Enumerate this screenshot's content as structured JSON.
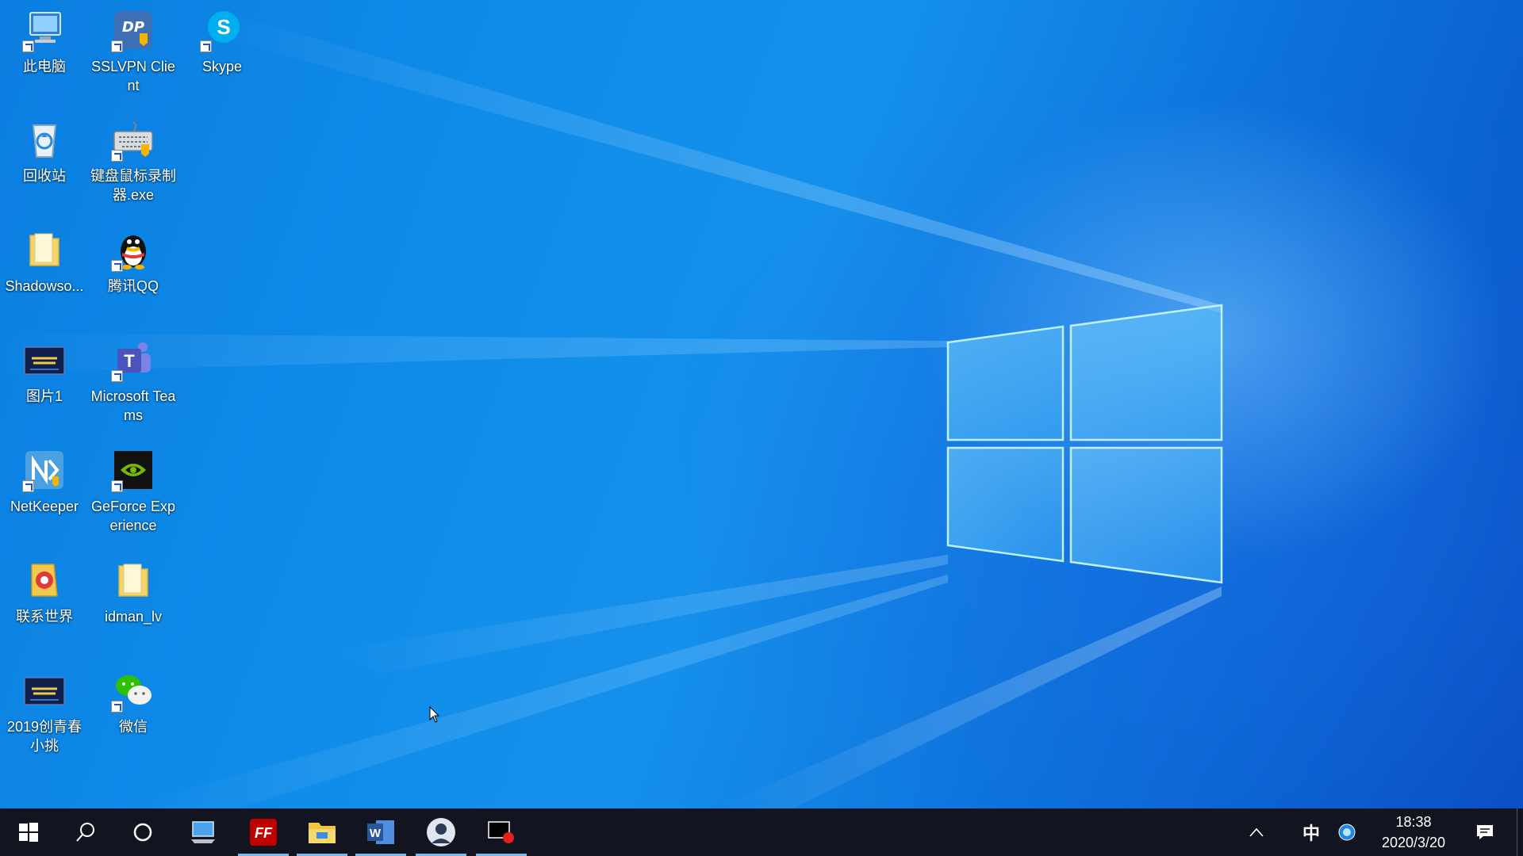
{
  "desktop": {
    "icons": [
      {
        "label": "此电脑",
        "icon": "this-pc-icon"
      },
      {
        "label": "SSLVPN Client",
        "icon": "sslvpn-icon"
      },
      {
        "label": "Skype",
        "icon": "skype-icon"
      },
      {
        "label": "回收站",
        "icon": "recycle-bin-icon"
      },
      {
        "label": "键盘鼠标录制器.exe",
        "icon": "keyboard-recorder-icon"
      },
      {
        "label": "Shadowso...",
        "icon": "folder-icon"
      },
      {
        "label": "腾讯QQ",
        "icon": "qq-icon"
      },
      {
        "label": "图片1",
        "icon": "image-icon"
      },
      {
        "label": "Microsoft Teams",
        "icon": "teams-icon"
      },
      {
        "label": "NetKeeper",
        "icon": "netkeeper-icon"
      },
      {
        "label": "GeForce Experience",
        "icon": "geforce-icon"
      },
      {
        "label": "联系世界",
        "icon": "contact-world-icon"
      },
      {
        "label": "idman_lv",
        "icon": "folder-icon"
      },
      {
        "label": "2019创青春小挑",
        "icon": "image-icon"
      },
      {
        "label": "微信",
        "icon": "wechat-icon"
      }
    ]
  },
  "taskbar": {
    "items": [
      {
        "name": "start",
        "icon": "windows-start-icon"
      },
      {
        "name": "search",
        "icon": "search-icon"
      },
      {
        "name": "cortana",
        "icon": "cortana-circle-icon"
      },
      {
        "name": "this-pc",
        "icon": "computer-icon"
      },
      {
        "name": "filezilla",
        "icon": "filezilla-icon"
      },
      {
        "name": "file-explorer",
        "icon": "file-explorer-icon"
      },
      {
        "name": "word",
        "icon": "word-icon"
      },
      {
        "name": "qq-avatar",
        "icon": "avatar-icon"
      },
      {
        "name": "screen-recorder",
        "icon": "record-icon"
      }
    ],
    "tray": {
      "show_hidden_icon": "chevron-up-icon",
      "ime": "中",
      "network_icon": "network-badge-icon",
      "time": "18:38",
      "date": "2020/3/20",
      "notification_icon": "action-center-icon"
    }
  },
  "colors": {
    "desktop_blue": "#0f8cea",
    "taskbar_bg": "#12151f",
    "active_indicator": "#76b9ed"
  }
}
